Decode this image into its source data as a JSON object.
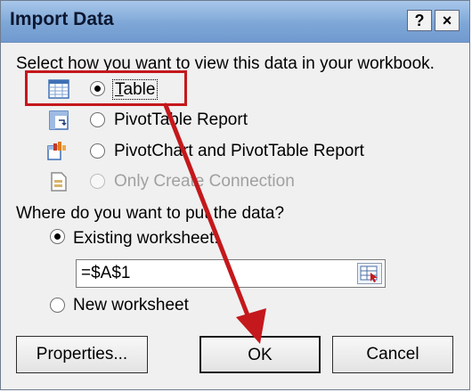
{
  "dialog": {
    "title": "Import Data",
    "help_glyph": "?",
    "close_glyph": "×"
  },
  "view_section": {
    "prompt": "Select how you want to view this data in your workbook.",
    "options": [
      {
        "label": "Table",
        "selected": true,
        "enabled": true,
        "icon": "table-icon"
      },
      {
        "label": "PivotTable Report",
        "selected": false,
        "enabled": true,
        "icon": "pivottable-icon"
      },
      {
        "label": "PivotChart and PivotTable Report",
        "selected": false,
        "enabled": true,
        "icon": "pivotchart-icon"
      },
      {
        "label": "Only Create Connection",
        "selected": false,
        "enabled": false,
        "icon": "connection-icon"
      }
    ]
  },
  "location_section": {
    "prompt": "Where do you want to put the data?",
    "existing_label": "Existing worksheet:",
    "existing_selected": true,
    "cell_reference": "=$A$1",
    "new_label": "New worksheet",
    "new_selected": false
  },
  "buttons": {
    "properties": "Properties...",
    "ok": "OK",
    "cancel": "Cancel"
  },
  "annotation": {
    "highlight_color": "#c4181c"
  }
}
